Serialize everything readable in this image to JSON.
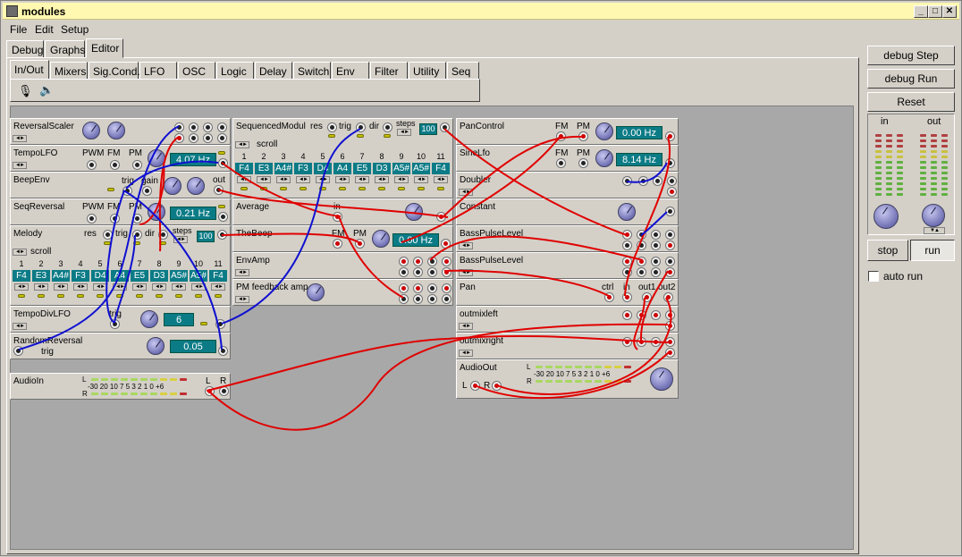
{
  "window": {
    "title": "modules"
  },
  "menu": {
    "file": "File",
    "edit": "Edit",
    "setup": "Setup"
  },
  "tabs": {
    "debug": "Debug",
    "graphs": "Graphs",
    "editor": "Editor"
  },
  "palette_tabs": [
    "In/Out",
    "Mixers",
    "Sig.Cond.",
    "LFO",
    "OSC",
    "Logic",
    "Delay",
    "Switch",
    "Env",
    "Filter",
    "Utility",
    "Seq"
  ],
  "right_panel": {
    "debug_step": "debug Step",
    "debug_run": "debug Run",
    "reset": "Reset",
    "in": "in",
    "out": "out",
    "stop": "stop",
    "run": "run",
    "auto_run": "auto run"
  },
  "modules": {
    "reversal_scaler": {
      "name": "ReversalScaler"
    },
    "tempo_lfo": {
      "name": "TempoLFO",
      "pwm": "PWM",
      "fm": "FM",
      "pm": "PM",
      "value": "4.07 Hz"
    },
    "beep_env": {
      "name": "BeepEnv",
      "trig": "trig",
      "gain": "gain",
      "out": "out"
    },
    "seq_reversal": {
      "name": "SeqReversal",
      "pwm": "PWM",
      "fm": "FM",
      "pm": "PM",
      "value": "0.21 Hz"
    },
    "melody": {
      "name": "Melody",
      "res": "res",
      "trig": "trig",
      "dir": "dir",
      "steps": "steps",
      "steps_value": "100",
      "scroll": "scroll",
      "step_numbers": [
        "1",
        "2",
        "3",
        "4",
        "5",
        "6",
        "7",
        "8",
        "9",
        "10",
        "11"
      ],
      "notes": [
        "F4",
        "E3",
        "A4#",
        "F3",
        "D4",
        "A4",
        "E5",
        "D3",
        "A5#",
        "A5#",
        "F4"
      ]
    },
    "tempo_div_lfo": {
      "name": "TempoDivLFO",
      "trig": "trig",
      "value": "6"
    },
    "random_reversal": {
      "name": "RandomReversal",
      "trig": "trig",
      "value": "0.05"
    },
    "audio_in": {
      "name": "AudioIn",
      "l": "L",
      "r": "R",
      "scale": "-30 20 10 7 5 3 2 1 0 +6"
    },
    "sequenced_modul": {
      "name": "SequencedModul",
      "res": "res",
      "trig": "trig",
      "dir": "dir",
      "steps": "steps",
      "steps_value": "100",
      "scroll": "scroll",
      "step_numbers": [
        "1",
        "2",
        "3",
        "4",
        "5",
        "6",
        "7",
        "8",
        "9",
        "10",
        "11"
      ],
      "notes": [
        "F4",
        "E3",
        "A4#",
        "F3",
        "D4",
        "A4",
        "E5",
        "D3",
        "A5#",
        "A5#",
        "F4"
      ]
    },
    "average": {
      "name": "Average",
      "in": "in"
    },
    "the_beep": {
      "name": "TheBeep",
      "fm": "FM",
      "pm": "PM",
      "value": "0.00 Hz"
    },
    "env_amp": {
      "name": "EnvAmp"
    },
    "pm_feedback": {
      "name": "PM feedback amp"
    },
    "pan_control": {
      "name": "PanControl",
      "fm": "FM",
      "pm": "PM",
      "value": "0.00 Hz"
    },
    "sine_lfo": {
      "name": "SineLfo",
      "fm": "FM",
      "pm": "PM",
      "value": "8.14 Hz"
    },
    "doubler": {
      "name": "Doubler"
    },
    "constant": {
      "name": "Constant"
    },
    "bass_pulse_level_1": {
      "name": "BassPulseLevel"
    },
    "bass_pulse_level_2": {
      "name": "BassPulseLevel"
    },
    "pan": {
      "name": "Pan",
      "ctrl": "ctrl",
      "in": "in",
      "out1": "out1",
      "out2": "out2"
    },
    "outmixleft": {
      "name": "outmixleft"
    },
    "outmixright": {
      "name": "outmixright"
    },
    "audio_out": {
      "name": "AudioOut",
      "l": "L",
      "r": "R",
      "scale": "-30 20 10 7 5 3 2 1 0 +6"
    }
  },
  "colors": {
    "cable_red": "#e00000",
    "cable_blue": "#1010d0",
    "display": "#0b7b86",
    "canvas": "#a8a8a8",
    "titlebar": "#fff8b0"
  }
}
